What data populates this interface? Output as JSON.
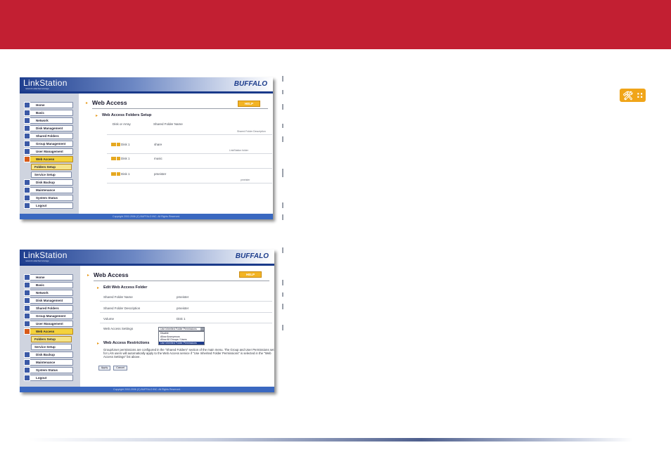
{
  "shot1": {
    "logo": "LinkStation",
    "tagline": "network attached storage",
    "brand": "BUFFALO",
    "nav": [
      "Home",
      "Basic",
      "Network",
      "Disk Management",
      "Shared Folders",
      "Group Management",
      "User Management",
      "Web Access",
      "Folders Setup",
      "Service Setup",
      "Disk Backup",
      "Maintenance",
      "System Status",
      "Logout"
    ],
    "page_title": "Web Access",
    "help_label": "HELP",
    "section_title": "Web Access Folders Setup",
    "col_disk": "Disk or Array",
    "col_name": "Shared Folder Name",
    "col_desc": "Shared Folder Description",
    "rows": [
      {
        "disk": "Disk 1",
        "name": "share",
        "desc": "LinkStation folder"
      },
      {
        "disk": "Disk 1",
        "name": "music",
        "desc": ""
      },
      {
        "disk": "Disk 1",
        "name": "pmeister",
        "desc": "pmeister"
      }
    ],
    "footer": "Copyright 2002-2006 (C) BUFFALO INC. All Rights Reserved."
  },
  "shot2": {
    "logo": "LinkStation",
    "tagline": "network attached storage",
    "brand": "BUFFALO",
    "nav": [
      "Home",
      "Basic",
      "Network",
      "Disk Management",
      "Shared Folders",
      "Group Management",
      "User Management",
      "Web Access",
      "Folders Setup",
      "Service Setup",
      "Disk Backup",
      "Maintenance",
      "System Status",
      "Logout"
    ],
    "page_title": "Web Access",
    "help_label": "HELP",
    "section_title": "Edit Web Access Folder",
    "fields": [
      {
        "label": "Shared Folder Name",
        "value": "pmeister"
      },
      {
        "label": "Shared Folder Description",
        "value": "pmeister"
      },
      {
        "label": "Volume",
        "value": "Disk 1"
      },
      {
        "label": "Web Access Settings",
        "value": ""
      }
    ],
    "select_value": "Use Inherited Folder Permissions",
    "select_options": [
      "Disable",
      "Allow Anonymous",
      "Allow All Groups / Users",
      "Use Inherited Folder Permissions"
    ],
    "restrictions_title": "Web Access Restrictions",
    "restrictions_text": "Group/User permissions are configured in the \"Shared Folders\" section of the main menu. The Group and User Permissions set for LAN users will automatically apply to the Web Access service if \"Use Inherited Folder Permissions\" is selected in the \"Web Access Settings\" list above.",
    "apply_label": "Apply",
    "cancel_label": "Cancel",
    "footer": "Copyright 2002-2006 (C) BUFFALO INC. All Rights Reserved."
  },
  "colors": {
    "banner": "#c21f32",
    "nav_blue": "#1f3f8f",
    "accent_orange": "#f3b424"
  }
}
